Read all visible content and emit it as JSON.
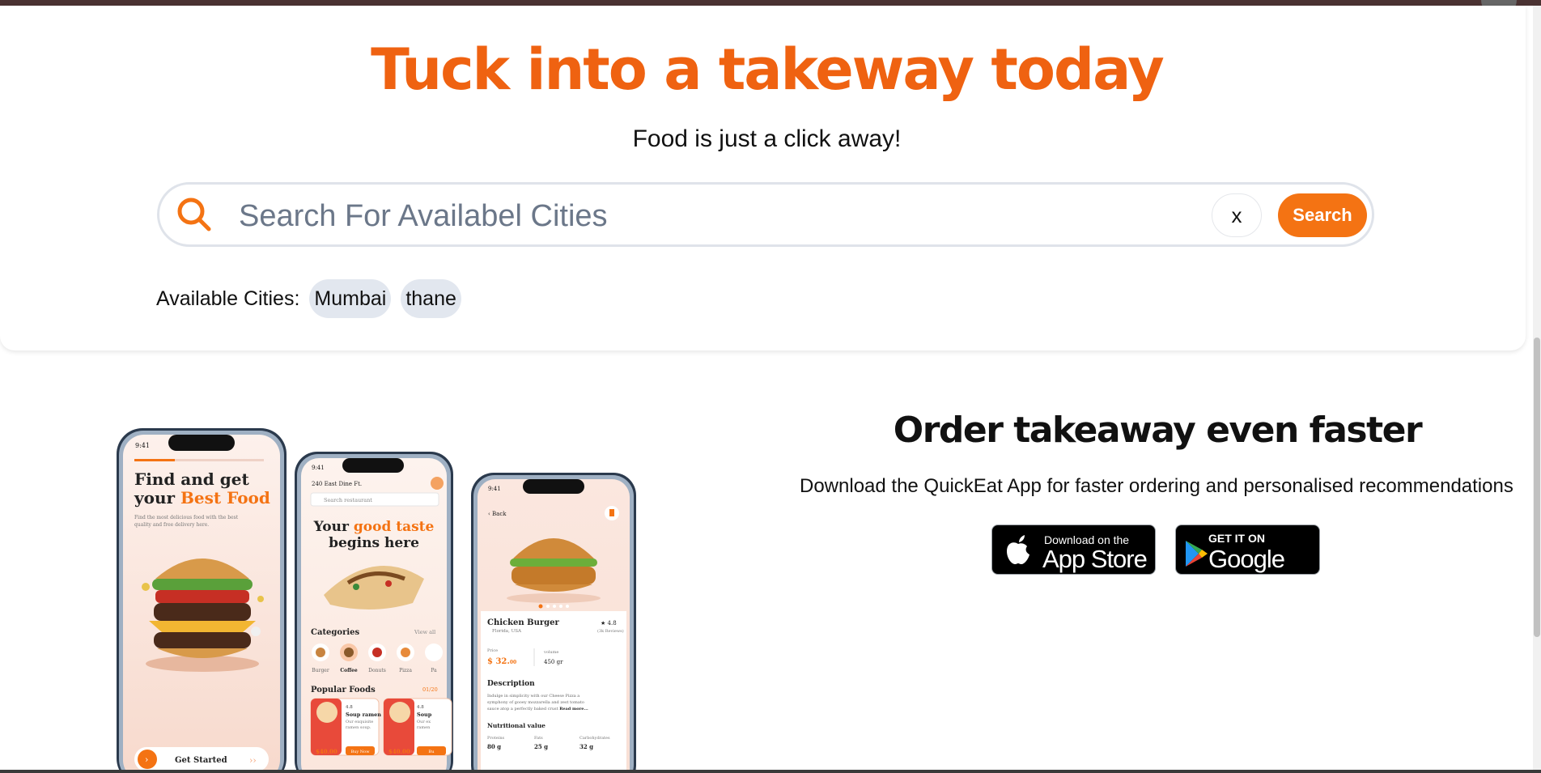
{
  "hero": {
    "title": "Tuck into a takeway today",
    "subtitle": "Food is just a click away!",
    "search": {
      "placeholder": "Search For Availabel Cities",
      "clear_label": "x",
      "button_label": "Search"
    },
    "cities_label": "Available Cities:",
    "cities": [
      "Mumbai",
      "thane"
    ]
  },
  "promo": {
    "title": "Order takeaway even faster",
    "description": "Download the QuickEat App for faster ordering and personalised recommendations",
    "app_store": {
      "small": "Download on the",
      "big": "App Store"
    },
    "google_play": {
      "small": "GET IT ON",
      "big": "Google play"
    }
  },
  "phone1": {
    "time": "9:41",
    "headline_1": "Find and get",
    "headline_2a": "your ",
    "headline_2b": "Best Food",
    "blurb_1": "Find the most delicious food with the best",
    "blurb_2": "quality and free delivery here.",
    "cta": "Get Started"
  },
  "phone2": {
    "time": "9:41",
    "location": "240 East Dine Ft.",
    "search_placeholder": "Search restaurant",
    "tagline_1a": "Your ",
    "tagline_1b": "good taste",
    "tagline_2": "begins here",
    "categories_title": "Categories",
    "view_all": "View all",
    "categories": [
      "Burger",
      "Coffee",
      "Donuts",
      "Pizza",
      "Pa"
    ],
    "popular_title": "Popular Foods",
    "pager": "01/20",
    "foods": [
      {
        "name": "Soup ramen",
        "rating": "4.8",
        "desc_1": "Our exquisite",
        "desc_2": "ramen soup.",
        "price": "$40.00",
        "cta": "Buy Now"
      },
      {
        "name": "Soup",
        "rating": "4.8",
        "desc_1": "Our ex",
        "desc_2": "ramen",
        "price": "$40.00",
        "cta": "Bu"
      }
    ]
  },
  "phone3": {
    "time": "9:41",
    "back": "Back",
    "name": "Chicken Burger",
    "rating": "4.8",
    "reviews": "(3k Reviews)",
    "location": "Florida, USA",
    "price_label": "Price",
    "price": "$ 32.",
    "price_cents": "00",
    "volume_label": "volume",
    "volume": "450 gr",
    "desc_title": "Description",
    "desc_1": "Indulge in simplicity with our Cheese Pizza a",
    "desc_2": "symphony of gooey mozzarella and zest tomato",
    "desc_3": "sauce atop a perfectly baked crust",
    "read_more": "Read more...",
    "nutrition_title": "Nutritional value",
    "nutrition": [
      {
        "label": "Proteins",
        "value": "80 g"
      },
      {
        "label": "Fats",
        "value": "25 g"
      },
      {
        "label": "Carbohydrates",
        "value": "32 g"
      }
    ]
  },
  "colors": {
    "accent": "#ef6211",
    "button": "#f47313",
    "chip": "#e2e7ef",
    "topbar": "#4a3232"
  }
}
